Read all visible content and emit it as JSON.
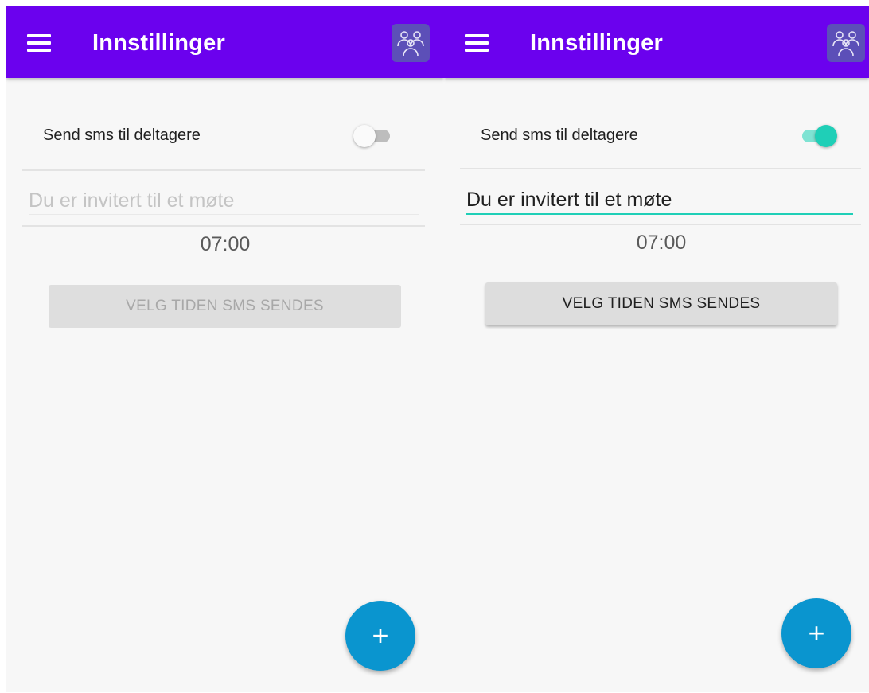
{
  "screens": [
    {
      "title": "Innstillinger",
      "menu_icon": "hamburger-menu-icon",
      "group_icon": "group-people-icon",
      "sms_label": "Send sms til deltagere",
      "sms_toggle_on": false,
      "message_value": "",
      "message_placeholder": "Du er invitert til et møte",
      "time": "07:00",
      "button_label": "VELG TIDEN SMS SENDES",
      "button_enabled": false,
      "fab_label": "+"
    },
    {
      "title": "Innstillinger",
      "menu_icon": "hamburger-menu-icon",
      "group_icon": "group-people-icon",
      "sms_label": "Send sms til deltagere",
      "sms_toggle_on": true,
      "message_value": "Du er invitert til et møte",
      "message_placeholder": "",
      "time": "07:00",
      "button_label": "VELG TIDEN SMS SENDES",
      "button_enabled": true,
      "fab_label": "+"
    }
  ],
  "colors": {
    "app_bar": "#6b01ee",
    "accent": "#1fcfb7",
    "fab": "#0a95cf"
  }
}
